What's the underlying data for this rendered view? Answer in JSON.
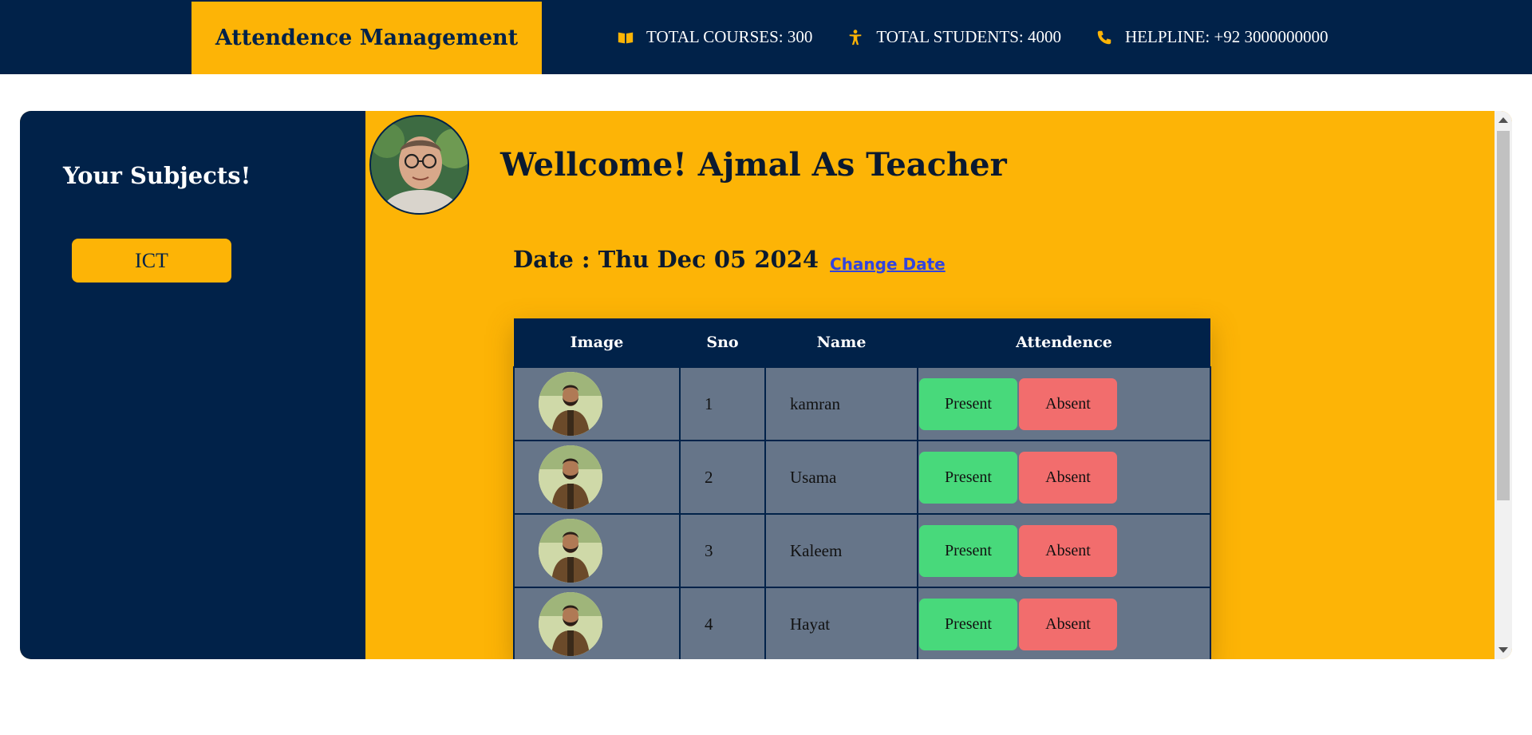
{
  "header": {
    "brand": "Attendence Management",
    "stats": [
      {
        "icon": "book-icon",
        "label": "TOTAL COURSES: 300"
      },
      {
        "icon": "person-icon",
        "label": "TOTAL STUDENTS: 4000"
      },
      {
        "icon": "phone-icon",
        "label": "HELPLINE: +92 3000000000"
      }
    ]
  },
  "sidebar": {
    "title": "Your Subjects!",
    "subjects": [
      "ICT"
    ]
  },
  "main": {
    "welcome": "Wellcome! Ajmal As Teacher",
    "date": "Date : Thu Dec 05 2024",
    "change_date": "Change Date",
    "columns": [
      "Image",
      "Sno",
      "Name",
      "Attendence"
    ],
    "present_label": "Present",
    "absent_label": "Absent",
    "students": [
      {
        "sno": "1",
        "name": "kamran"
      },
      {
        "sno": "2",
        "name": "Usama"
      },
      {
        "sno": "3",
        "name": "Kaleem"
      },
      {
        "sno": "4",
        "name": "Hayat"
      }
    ]
  },
  "colors": {
    "navy": "#012249",
    "accent": "#fdb406",
    "present": "#48d97b",
    "absent": "#f26d6d",
    "row": "#667589"
  }
}
